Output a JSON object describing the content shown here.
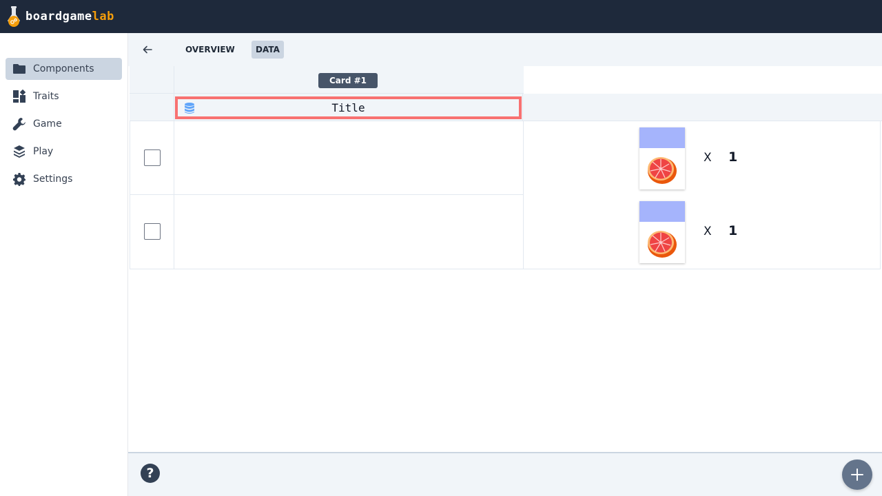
{
  "brand": {
    "name_part1": "boardgame",
    "name_part2": "lab",
    "accent": "#f59e0b"
  },
  "sidebar": {
    "items": [
      {
        "label": "Components",
        "icon": "folder-icon",
        "active": true
      },
      {
        "label": "Traits",
        "icon": "dashboard-icon",
        "active": false
      },
      {
        "label": "Game",
        "icon": "wrench-icon",
        "active": false
      },
      {
        "label": "Play",
        "icon": "layers-icon",
        "active": false
      },
      {
        "label": "Settings",
        "icon": "gear-icon",
        "active": false
      }
    ]
  },
  "tabs": {
    "overview": "OVERVIEW",
    "data": "DATA",
    "active": "DATA"
  },
  "table": {
    "column_header": "Card #1",
    "field_title": "Title",
    "rows": [
      {
        "checked": false,
        "multiplier_x": "X",
        "count": "1",
        "preview_color": "#a5b4fc",
        "image": "grapefruit-image"
      },
      {
        "checked": false,
        "multiplier_x": "X",
        "count": "1",
        "preview_color": "#a5b4fc",
        "image": "grapefruit-image"
      }
    ]
  },
  "footer": {
    "help_label": "?",
    "add_icon": "plus-icon"
  }
}
